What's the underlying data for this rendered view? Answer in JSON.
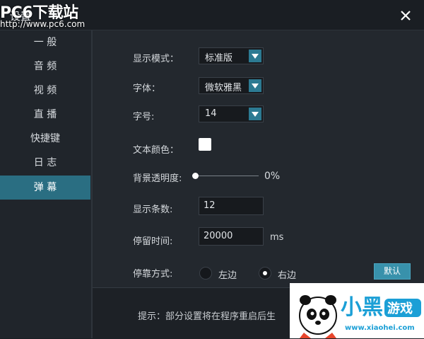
{
  "watermark": {
    "site": "PC6下载站",
    "url": "http://www.pc6.com"
  },
  "window": {
    "title": "设置"
  },
  "sidebar": {
    "items": [
      {
        "label": "一 般"
      },
      {
        "label": "音 频"
      },
      {
        "label": "视 频"
      },
      {
        "label": "直 播"
      },
      {
        "label": "快捷键"
      },
      {
        "label": "日 志"
      },
      {
        "label": "弹 幕",
        "active": true
      }
    ]
  },
  "form": {
    "display_mode": {
      "label": "显示模式：",
      "value": "标准版"
    },
    "font": {
      "label": "字体：",
      "value": "微软雅黑"
    },
    "font_size": {
      "label": "字号:",
      "value": "14"
    },
    "text_color": {
      "label": "文本颜色：",
      "color": "#ffffff"
    },
    "bg_opacity": {
      "label": "背景透明度:",
      "value": "0%"
    },
    "count": {
      "label": "显示条数:",
      "value": "12"
    },
    "stay_time": {
      "label": "停留时间:",
      "value": "20000",
      "unit": "ms"
    },
    "dock": {
      "label": "停靠方式:",
      "options": [
        {
          "label": "左边",
          "selected": false
        },
        {
          "label": "右边",
          "selected": true
        }
      ]
    },
    "default_button": "默认"
  },
  "footer": {
    "hint": "提示：部分设置将在程序重启后生"
  },
  "logo": {
    "text_main": "小黑",
    "text_sub": "游戏",
    "url": "www.xiaohei.com"
  },
  "colors": {
    "accent": "#2a6e82",
    "button": "#3891ab",
    "background": "#22272d"
  }
}
